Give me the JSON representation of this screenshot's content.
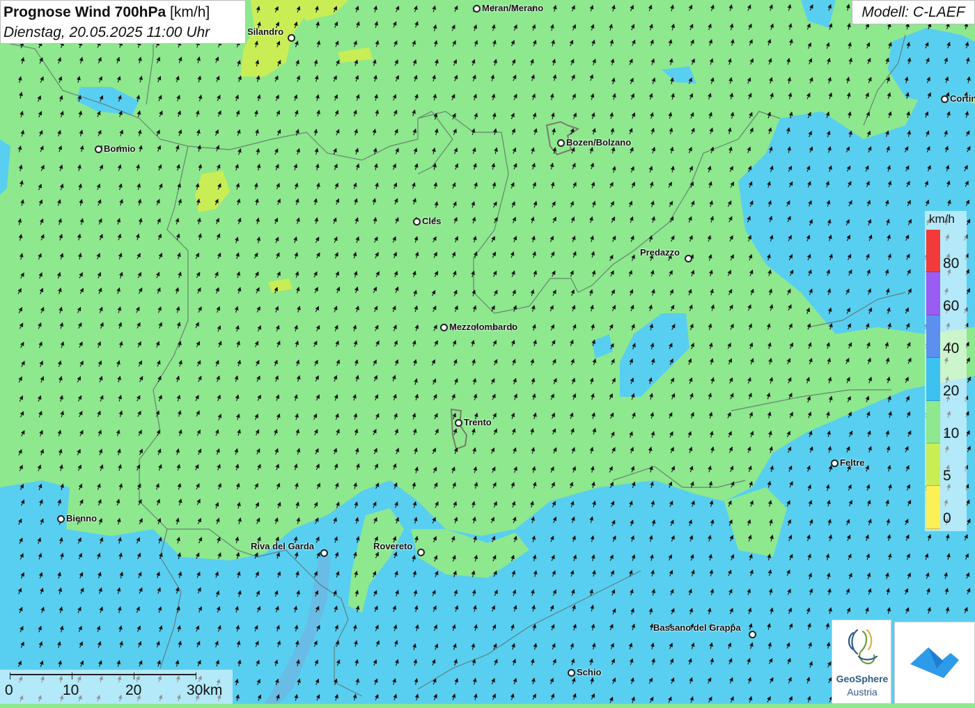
{
  "title": {
    "main": "Prognose Wind 700hPa",
    "unit": "[km/h]",
    "datetime": "Dienstag, 20.05.2025 11:00 Uhr"
  },
  "model": "Modell: C-LAEF",
  "legend": {
    "unit": "km/h",
    "labels": [
      "80",
      "60",
      "40",
      "20",
      "10",
      "5",
      "0"
    ],
    "colors": [
      "#f23a3a",
      "#9a5cf2",
      "#5b8ff0",
      "#3cc2f0",
      "#8ee88e",
      "#c9ee55",
      "#fbf056"
    ]
  },
  "scale": {
    "labels": [
      "0",
      "10",
      "20",
      "30km"
    ]
  },
  "cities": [
    {
      "name": "Meran/Merano",
      "label_side": "right"
    },
    {
      "name": "Silandro",
      "label_side": "left"
    },
    {
      "name": "Cortina",
      "label_side": "right"
    },
    {
      "name": "Bormio",
      "label_side": "right"
    },
    {
      "name": "Bozen/Bolzano",
      "label_side": "right"
    },
    {
      "name": "Cles",
      "label_side": "right"
    },
    {
      "name": "Predazzo",
      "label_side": "left"
    },
    {
      "name": "Mezzolombardo",
      "label_side": "right"
    },
    {
      "name": "Trento",
      "label_side": "right"
    },
    {
      "name": "Feltre",
      "label_side": "right"
    },
    {
      "name": "Bienno",
      "label_side": "right"
    },
    {
      "name": "Riva del Garda",
      "label_side": "left"
    },
    {
      "name": "Rovereto",
      "label_side": "left"
    },
    {
      "name": "Bassano del Grappa",
      "label_side": "left"
    },
    {
      "name": "Schio",
      "label_side": "right"
    }
  ],
  "logos": {
    "geosphere_line1": "GeoSphere",
    "geosphere_line2": "Austria"
  },
  "wind_direction": "south-southwest"
}
